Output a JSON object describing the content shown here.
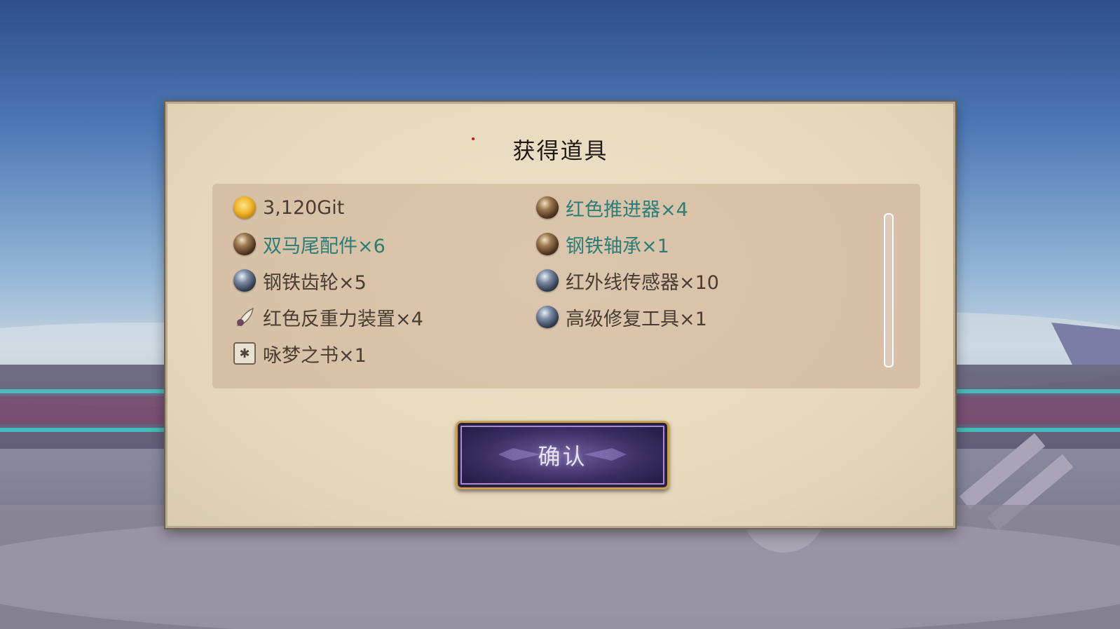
{
  "dialog": {
    "title": "获得道具",
    "confirm_label": "确认"
  },
  "items": [
    {
      "label": "3,120Git",
      "icon": "gold-coin-icon",
      "rare": false
    },
    {
      "label": "红色推进器×4",
      "icon": "bronze-orb-icon",
      "rare": true
    },
    {
      "label": "双马尾配件×6",
      "icon": "bronze-orb-icon",
      "rare": true
    },
    {
      "label": "钢铁轴承×1",
      "icon": "bronze-orb-icon",
      "rare": true
    },
    {
      "label": "钢铁齿轮×5",
      "icon": "steel-orb-icon",
      "rare": false
    },
    {
      "label": "红外线传感器×10",
      "icon": "steel-orb-icon",
      "rare": false
    },
    {
      "label": "红色反重力装置×4",
      "icon": "feather-icon",
      "rare": false
    },
    {
      "label": "高级修复工具×1",
      "icon": "steel-orb-icon",
      "rare": false
    },
    {
      "label": "咏梦之书×1",
      "icon": "book-icon",
      "rare": false
    }
  ],
  "colors": {
    "rare_text": "#2c7d77",
    "normal_text": "#4a3c33",
    "button_border": "#c8a24a"
  }
}
